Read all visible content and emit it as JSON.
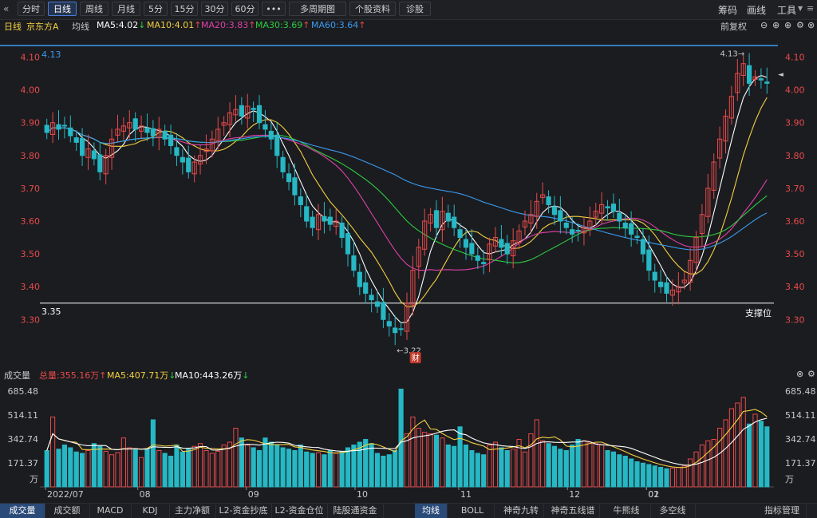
{
  "toolbar": {
    "back_icon": "chevron-left-icon",
    "tabs": [
      "分时",
      "日线",
      "周线",
      "月线",
      "5分",
      "15分",
      "30分",
      "60分",
      "•••",
      "多周期图",
      "个股资料",
      "诊股"
    ],
    "active_tab": "日线",
    "right_items": [
      "筹码",
      "画线",
      "工具"
    ]
  },
  "info": {
    "period": "日线",
    "stock": "京东方A",
    "avg_label": "均线",
    "ma": [
      {
        "text": "MA5:4.02",
        "arrow": "↓",
        "color": "#ffffff"
      },
      {
        "text": "MA10:4.01",
        "arrow": "↑",
        "color": "#f4d03f"
      },
      {
        "text": "MA20:3.83",
        "arrow": "↑",
        "color": "#e040a8"
      },
      {
        "text": "MA30:3.69",
        "arrow": "↑",
        "color": "#2ecc40"
      },
      {
        "text": "MA60:3.64",
        "arrow": "↑",
        "color": "#3a9bf0"
      }
    ],
    "right_label": "前复权"
  },
  "chart_data": [
    {
      "type": "candlestick",
      "title": "京东方A 日线",
      "ylim": [
        3.22,
        4.13
      ],
      "y_ticks": [
        "4.10",
        "4.00",
        "3.90",
        "3.80",
        "3.70",
        "3.60",
        "3.50",
        "3.40",
        "3.30"
      ],
      "x_ticks": [
        "2022/07",
        "08",
        "09",
        "10",
        "11",
        "12",
        "01",
        "02"
      ],
      "annotations": {
        "high_label": "4.13",
        "high_marker": "4.13→",
        "low_marker": "←3.22",
        "top_line_label": "4.13",
        "support_line_label": "3.35",
        "support_text": "支撑位",
        "badge": "财"
      },
      "ma_legend": [
        "MA5",
        "MA10",
        "MA20",
        "MA30",
        "MA60"
      ],
      "closes": [
        3.87,
        3.9,
        3.88,
        3.89,
        3.86,
        3.84,
        3.8,
        3.82,
        3.79,
        3.75,
        3.8,
        3.85,
        3.88,
        3.89,
        3.9,
        3.88,
        3.89,
        3.87,
        3.86,
        3.88,
        3.85,
        3.83,
        3.8,
        3.78,
        3.75,
        3.78,
        3.8,
        3.82,
        3.85,
        3.88,
        3.9,
        3.93,
        3.94,
        3.92,
        3.95,
        3.94,
        3.9,
        3.88,
        3.85,
        3.8,
        3.75,
        3.72,
        3.68,
        3.65,
        3.6,
        3.58,
        3.62,
        3.6,
        3.59,
        3.6,
        3.55,
        3.5,
        3.45,
        3.4,
        3.38,
        3.36,
        3.34,
        3.3,
        3.28,
        3.26,
        3.27,
        3.35,
        3.45,
        3.52,
        3.6,
        3.62,
        3.58,
        3.63,
        3.6,
        3.58,
        3.55,
        3.52,
        3.5,
        3.48,
        3.47,
        3.53,
        3.55,
        3.52,
        3.5,
        3.54,
        3.57,
        3.6,
        3.62,
        3.66,
        3.68,
        3.65,
        3.62,
        3.6,
        3.58,
        3.56,
        3.57,
        3.58,
        3.6,
        3.63,
        3.65,
        3.64,
        3.63,
        3.6,
        3.58,
        3.56,
        3.55,
        3.5,
        3.45,
        3.42,
        3.4,
        3.38,
        3.39,
        3.4,
        3.42,
        3.48,
        3.55,
        3.62,
        3.7,
        3.78,
        3.85,
        3.92,
        3.98,
        4.05,
        4.08,
        4.02,
        4.04,
        4.03,
        4.02
      ],
      "volumes": [
        260,
        500,
        270,
        300,
        280,
        250,
        240,
        260,
        310,
        290,
        255,
        230,
        245,
        350,
        280,
        265,
        210,
        270,
        480,
        260,
        240,
        220,
        300,
        250,
        270,
        290,
        310,
        260,
        240,
        255,
        300,
        320,
        420,
        350,
        300,
        280,
        260,
        350,
        320,
        300,
        280,
        270,
        260,
        300,
        250,
        240,
        245,
        230,
        260,
        240,
        250,
        280,
        300,
        320,
        340,
        310,
        240,
        220,
        230,
        260,
        700,
        380,
        500,
        420,
        390,
        380,
        370,
        350,
        300,
        290,
        430,
        300,
        260,
        240,
        230,
        300,
        320,
        280,
        260,
        270,
        340,
        250,
        380,
        480,
        330,
        310,
        290,
        270,
        260,
        300,
        340,
        330,
        320,
        310,
        300,
        260,
        250,
        230,
        220,
        200,
        180,
        170,
        160,
        150,
        140,
        130,
        135,
        140,
        150,
        200,
        250,
        300,
        330,
        340,
        420,
        480,
        560,
        600,
        640,
        450,
        520,
        470,
        430
      ],
      "vol_ylim": [
        0,
        685.48
      ],
      "vol_ticks": [
        "685.48",
        "514.11",
        "342.74",
        "171.37",
        "万"
      ],
      "vol_info": {
        "label": "成交量",
        "total": "总量:355.16万",
        "total_arrow": "↑",
        "ma5": "MA5:407.71万",
        "ma5_arrow": "↓",
        "ma10": "MA10:443.26万",
        "ma10_arrow": "↓"
      }
    }
  ],
  "bottom_tabs": [
    "成交量",
    "成交额",
    "MACD",
    "KDJ",
    "主力净额",
    "L2-资金抄底",
    "L2-资金仓位",
    "陆股通资金",
    "均线",
    "BOLL",
    "神奇九转",
    "神奇五线谱",
    "牛熊线",
    "多空线",
    "指标管理"
  ],
  "bottom_active": [
    "成交量",
    "均线"
  ],
  "colors": {
    "up": "#e84a4a",
    "down": "#26b8c4",
    "bg": "#1b1c20",
    "grid": "#2c2d33",
    "accent": "#4b7bd8"
  }
}
